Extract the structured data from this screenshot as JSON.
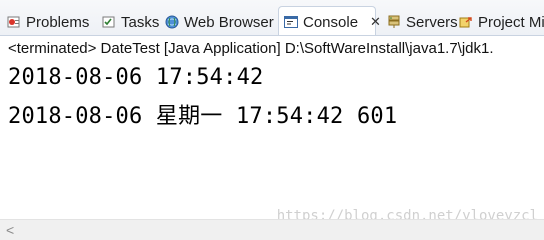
{
  "tabs": [
    {
      "label": "Problems",
      "icon": "problems-icon"
    },
    {
      "label": "Tasks",
      "icon": "tasks-icon"
    },
    {
      "label": "Web Browser",
      "icon": "web-browser-icon"
    },
    {
      "label": "Console",
      "icon": "console-icon",
      "active": true,
      "close": "✕"
    },
    {
      "label": "Servers",
      "icon": "servers-icon"
    },
    {
      "label": "Project Mi",
      "icon": "project-migration-icon"
    }
  ],
  "status": "<terminated> DateTest [Java Application] D:\\SoftWareInstall\\java1.7\\jdk1.",
  "console": {
    "lines": [
      "2018-08-06 17:54:42",
      "2018-08-06 星期一 17:54:42 601"
    ]
  },
  "watermark": "https://blog.csdn.net/yloveyzcl",
  "scrollbar": {
    "left_arrow": "<"
  },
  "colors": {
    "tab_bar_bg": "#eef1f6",
    "active_tab_bg": "#ffffff",
    "border": "#c9d3e1",
    "text": "#000000",
    "watermark": "#d0d0d0"
  }
}
